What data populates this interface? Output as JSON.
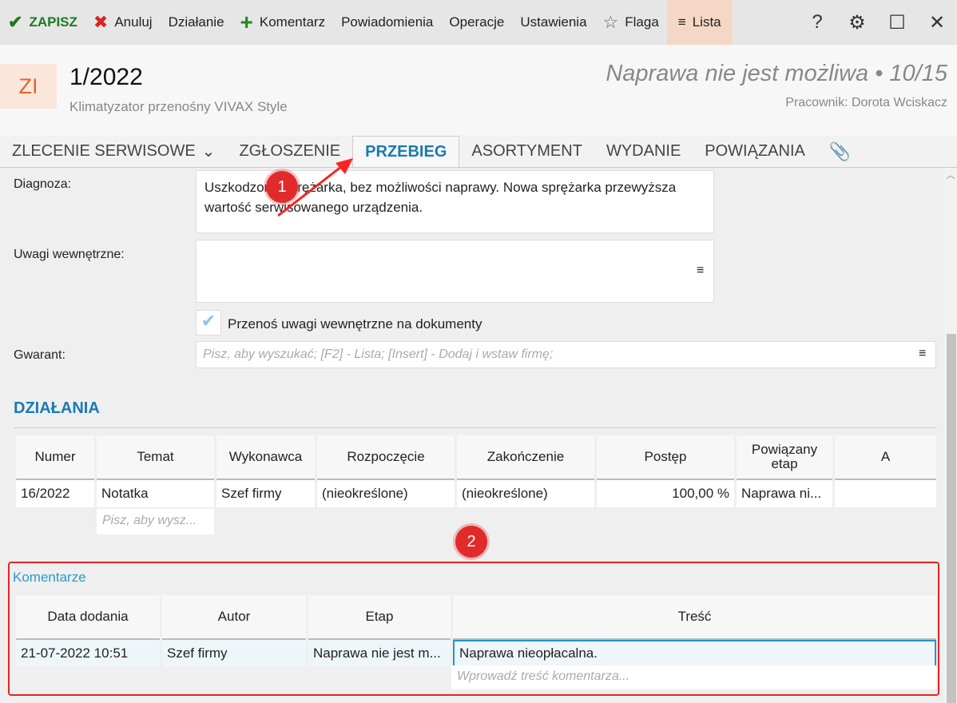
{
  "toolbar": {
    "save": "ZAPISZ",
    "cancel": "Anuluj",
    "action": "Działanie",
    "comment": "Komentarz",
    "notifications": "Powiadomienia",
    "operations": "Operacje",
    "settings": "Ustawienia",
    "flag": "Flaga",
    "list": "Lista"
  },
  "header": {
    "badge": "ZI",
    "number": "1/2022",
    "subtitle": "Klimatyzator przenośny VIVAX Style",
    "status": "Naprawa nie jest możliwa • 10/15",
    "worker": "Pracownik: Dorota Wciskacz"
  },
  "tabs": [
    "ZLECENIE SERWISOWE",
    "ZGŁOSZENIE",
    "PRZEBIEG",
    "ASORTYMENT",
    "WYDANIE",
    "POWIĄZANIA"
  ],
  "form": {
    "diagnosis_label": "Diagnoza:",
    "diagnosis_value": "Uszkodzona sprężarka, bez możliwości naprawy. Nowa sprężarka przewyższa wartość serwisowanego urządzenia.",
    "notes_label": "Uwagi wewnętrzne:",
    "notes_value": "",
    "transfer_label": "Przenoś uwagi wewnętrzne na dokumenty",
    "guarantor_label": "Gwarant:",
    "guarantor_placeholder": "Pisz, aby wyszukać; [F2] - Lista; [Insert] - Dodaj i wstaw firmę;"
  },
  "actions": {
    "title": "DZIAŁANIA",
    "columns": [
      "Numer",
      "Temat",
      "Wykonawca",
      "Rozpoczęcie",
      "Zakończenie",
      "Postęp",
      "Powiązany etap",
      "A"
    ],
    "rows": [
      [
        "16/2022",
        "Notatka",
        "Szef firmy",
        "(nieokreślone)",
        "(nieokreślone)",
        "100,00 %",
        "Naprawa ni...",
        ""
      ]
    ],
    "new_placeholder": "Pisz, aby wysz..."
  },
  "comments": {
    "title": "Komentarze",
    "columns": [
      "Data dodania",
      "Autor",
      "Etap",
      "Treść"
    ],
    "rows": [
      [
        "21-07-2022 10:51",
        "Szef firmy",
        "Naprawa nie jest m...",
        "Naprawa nieopłacalna."
      ]
    ],
    "new_placeholder": "Wprowadź treść komentarza..."
  },
  "annotations": [
    "1",
    "2"
  ]
}
